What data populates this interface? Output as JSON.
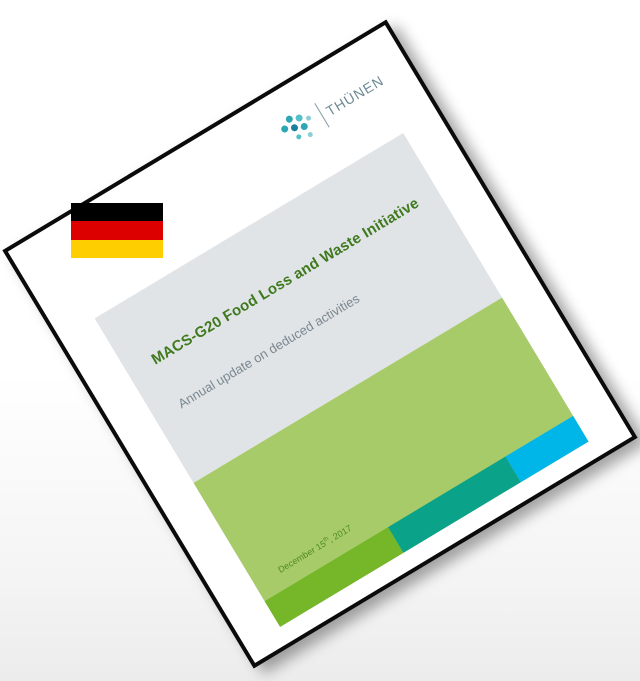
{
  "document": {
    "logo_text": "THÜNEN",
    "title": "MACS-G20 Food Loss and Waste Initiative",
    "subtitle": "Annual update on deduced activities",
    "date_prefix": "December 15",
    "date_sup": "th",
    "date_suffix": ", 2017"
  },
  "colors": {
    "cover_grey": "#e1e4e7",
    "green_band": "#a8cb69",
    "dark_green": "#76b72a",
    "teal": "#0aa389",
    "cyan": "#00b6e8",
    "logo_teal": "#2fa6b3",
    "flag_black": "#000000",
    "flag_red": "#dd0000",
    "flag_gold": "#ffce00"
  },
  "flag": {
    "country": "Germany",
    "icon": "german-flag-icon"
  }
}
